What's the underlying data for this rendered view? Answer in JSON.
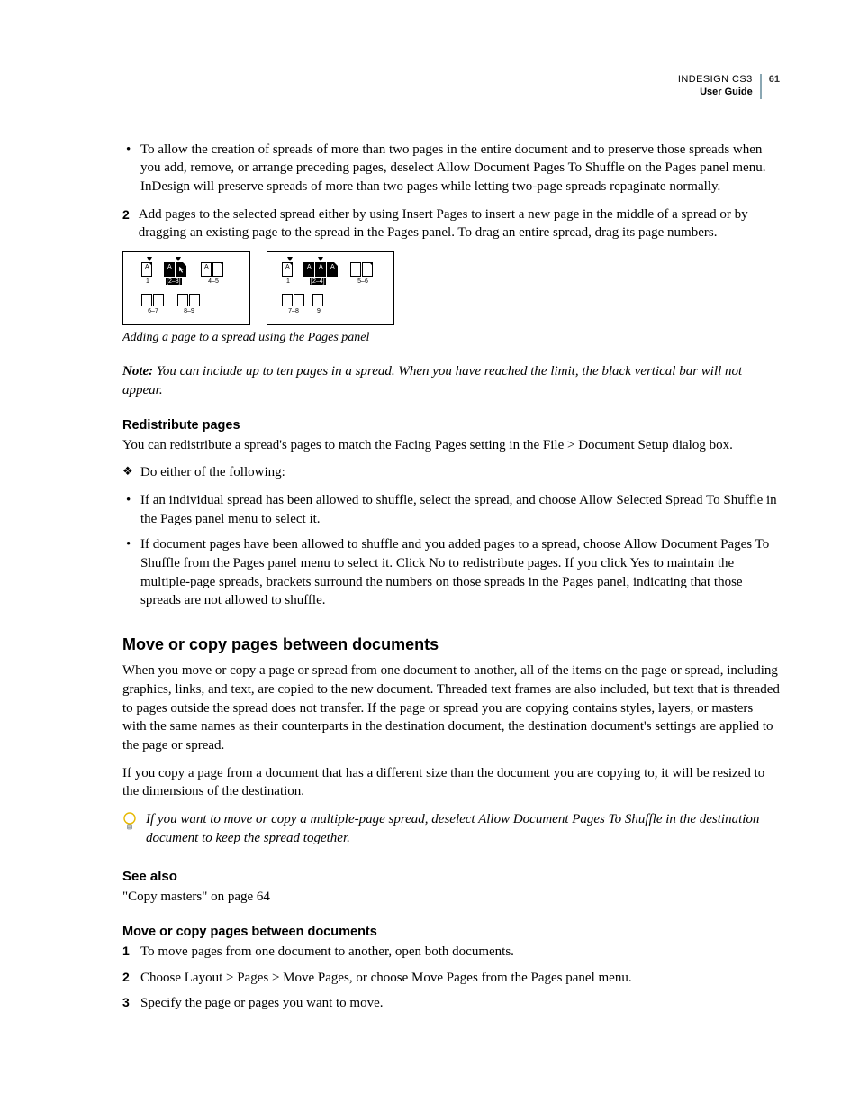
{
  "runhead": {
    "product": "INDESIGN CS3",
    "doc": "User Guide",
    "page": "61"
  },
  "bullet1": "To allow the creation of spreads of more than two pages in the entire document and to preserve those spreads when you add, remove, or arrange preceding pages, deselect Allow Document Pages To Shuffle on the Pages panel menu. InDesign will preserve spreads of more than two pages while letting two-page spreads repaginate normally.",
  "step2": {
    "n": "2",
    "t": "Add pages to the selected spread either by using Insert Pages to insert a new page in the middle of a spread or by dragging an existing page to the spread in the Pages panel. To drag an entire spread, drag its page numbers."
  },
  "fig": {
    "caption": "Adding a page to a spread using the Pages panel",
    "left": {
      "r1": "1",
      "r2": "[2–3]",
      "r3": "4–5",
      "b1": "6–7",
      "b2": "8–9",
      "letter": "A"
    },
    "right": {
      "r1": "1",
      "r2": "[2–4]",
      "r3": "5–6",
      "b1": "7–8",
      "b2": "9",
      "letter": "A"
    }
  },
  "note": {
    "label": "Note:",
    "body": "You can include up to ten pages in a spread. When you have reached the limit, the black vertical bar will not appear."
  },
  "redis": {
    "h": "Redistribute pages",
    "intro": "You can redistribute a spread's pages to match the Facing Pages setting in the File > Document Setup dialog box.",
    "lead": "Do either of the following:",
    "b1": "If an individual spread has been allowed to shuffle, select the spread, and choose Allow Selected Spread To Shuffle in the Pages panel menu to select it.",
    "b2": "If document pages have been allowed to shuffle and you added pages to a spread, choose Allow Document Pages To Shuffle from the Pages panel menu to select it. Click No to redistribute pages. If you click Yes to maintain the multiple-page spreads, brackets surround the numbers on those spreads in the Pages panel, indicating that those spreads are not allowed to shuffle."
  },
  "move": {
    "h": "Move or copy pages between documents",
    "p1": "When you move or copy a page or spread from one document to another, all of the items on the page or spread, including graphics, links, and text, are copied to the new document. Threaded text frames are also included, but text that is threaded to pages outside the spread does not transfer. If the page or spread you are copying contains styles, layers, or masters with the same names as their counterparts in the destination document, the destination document's settings are applied to the page or spread.",
    "p2": "If you copy a page from a document that has a different size than the document you are copying to, it will be resized to the dimensions of the destination.",
    "tip": "If you want to move or copy a multiple-page spread, deselect Allow Document Pages To Shuffle in the destination document to keep the spread together."
  },
  "seealso": {
    "h": "See also",
    "link": "\"Copy masters\" on page 64"
  },
  "steps": {
    "h": "Move or copy pages between documents",
    "s1": {
      "n": "1",
      "t": "To move pages from one document to another, open both documents."
    },
    "s2": {
      "n": "2",
      "t": "Choose Layout > Pages > Move Pages, or choose Move Pages from the Pages panel menu."
    },
    "s3": {
      "n": "3",
      "t": "Specify the page or pages you want to move."
    }
  }
}
